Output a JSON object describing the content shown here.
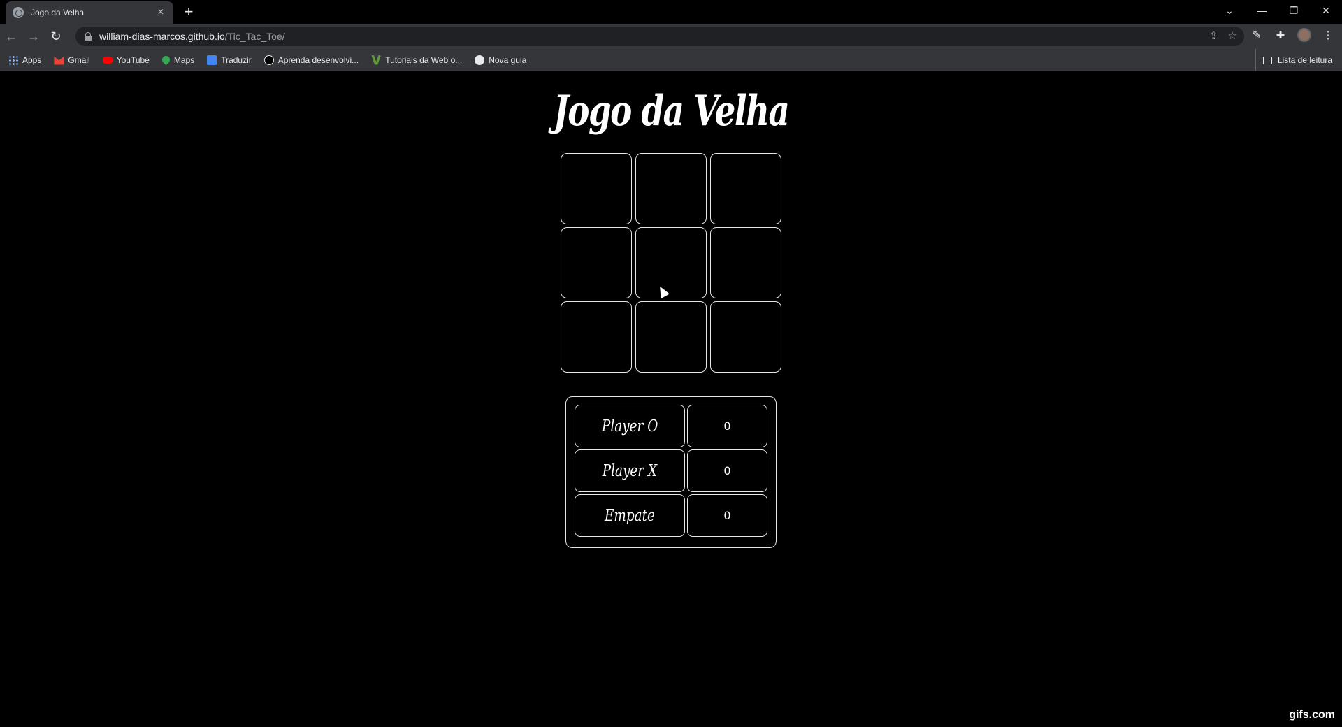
{
  "browser": {
    "tab": {
      "title": "Jogo da Velha",
      "close": "×"
    },
    "new_tab": "+",
    "window_controls": [
      "⌄",
      "—",
      "❐",
      "✕"
    ],
    "nav": {
      "back": "←",
      "forward": "→",
      "reload": "↻"
    },
    "url": {
      "host": "william-dias-marcos.github.io",
      "path": "/Tic_Tac_Toe/"
    },
    "omnibox_icons": [
      "share-icon",
      "star-icon"
    ],
    "toolbar_icons": [
      "pen-icon",
      "extensions-icon",
      "avatar",
      "menu-icon"
    ],
    "bookmarks": [
      {
        "label": "Apps",
        "icon": "apps-icon"
      },
      {
        "label": "Gmail",
        "icon": "gmail-icon"
      },
      {
        "label": "YouTube",
        "icon": "youtube-icon"
      },
      {
        "label": "Maps",
        "icon": "maps-icon"
      },
      {
        "label": "Traduzir",
        "icon": "translate-icon"
      },
      {
        "label": "Aprenda desenvolvi...",
        "icon": "graduation-icon"
      },
      {
        "label": "Tutoriais da Web o...",
        "icon": "w-icon"
      },
      {
        "label": "Nova guia",
        "icon": "globe-icon"
      }
    ],
    "reading_list": "Lista de leitura"
  },
  "game": {
    "title": "Jogo da Velha",
    "board": [
      "",
      "",
      "",
      "",
      "",
      "",
      "",
      "",
      ""
    ],
    "scoreboard": [
      {
        "label": "Player O",
        "value": "0"
      },
      {
        "label": "Player X",
        "value": "0"
      },
      {
        "label": "Empate",
        "value": "0"
      }
    ]
  },
  "watermark": "gifs.com",
  "colors": {
    "background": "#000000",
    "border": "#e6e6e6",
    "chrome": "#35363a"
  }
}
